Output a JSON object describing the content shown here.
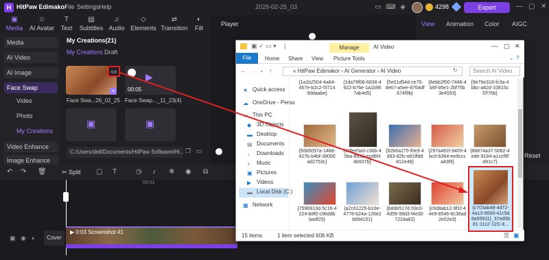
{
  "app": {
    "title": "HitPaw Edimakor",
    "menus": [
      "File",
      "Settings",
      "Help"
    ],
    "doc_title": "2026-02-25_03",
    "coins": "4298",
    "export_label": "Export"
  },
  "toolbar": {
    "tools": [
      "Media",
      "AI Avatar",
      "Text",
      "Subtitles",
      "Audio",
      "Elements",
      "Transition",
      "Filt"
    ],
    "icons": [
      "media-icon",
      "avatar-icon",
      "text-icon",
      "subtitles-icon",
      "audio-icon",
      "elements-icon",
      "transition-icon",
      "filter-icon"
    ]
  },
  "sidebar": {
    "items": [
      "Media",
      "AI Video",
      "AI Image",
      "Face Swap",
      "Video Enhance",
      "Image Enhance"
    ],
    "sub": [
      "Video",
      "Photo",
      "My Creations"
    ]
  },
  "content": {
    "header": "My Creations(21)",
    "tabs": [
      "My Creations",
      "Draft"
    ],
    "items": [
      {
        "label": "Face Swa...26_02_25"
      },
      {
        "label": "Face Swap..._11_23(4)",
        "time": "00:05"
      }
    ],
    "path": "C:/Users/dell/Documents/HitPaw Software/Hi..."
  },
  "player": {
    "label": "Player"
  },
  "right": {
    "tabs": [
      "View",
      "Animation",
      "Color",
      "AIGC"
    ],
    "reset": "Reset"
  },
  "timeline": {
    "split": "Split",
    "ruler": "00:01",
    "cover": "Cover",
    "clip_time": "0:03",
    "clip_name": "Screenshot 41"
  },
  "explorer": {
    "title": "AI Video",
    "manage": "Manage",
    "tabs": [
      "File",
      "Home",
      "Share",
      "View",
      "Picture Tools"
    ],
    "path": [
      "HitPaw Edimakor",
      "AI Generator",
      "AI Video"
    ],
    "search_placeholder": "Search AI Video",
    "nav": [
      "Quick access",
      "OneDrive - Perso",
      "This PC",
      "3D Objects",
      "Desktop",
      "Documents",
      "Downloads",
      "Music",
      "Pictures",
      "Videos",
      "Local Disk (C:)",
      "Network"
    ],
    "status_items": "15 items",
    "status_sel": "1 item selected  606 KB",
    "row1": [
      "{1a1b2504-4a84-457e-b2c2-f3714 9ddaabe}",
      "{1da76f06-6836-4 922-b76e-1a1b96 7ab4d5}",
      "{5e01d54d-ce75-4e67-a5ee-8764df 674f9b}",
      "{6ebb2f50-7446-4 b6f-b5e1-2bf75b 3e4593}",
      "{9e76e318-fc3a-4 bbc-a82d-10815c f2f76b}"
    ],
    "row2": [
      "{50b5097a-148d-427b-b4bf-38000 ad2753c}",
      "{60fee5a3-c36b-4 0ba-8932-ecd6f4 4b937b}",
      "{92b6a275-f0e9-4 d93-82fc-e81ffdd 812e48}",
      "{297a481f-9409-4 bc0-b364-ee9ccc a43f9}",
      "{88874a37-5082-4 ede-9184-a1ccf9f d91c7}"
    ],
    "row3": [
      "{7596913d-5c16-4 224-b8f0-c96ddb badf25}",
      "{a2c61225-b10e-4778-b24a-126e2 b894151}",
      "{b8de517d-59c0-4d59-99d3-f4e30 7224a82}",
      "{c6d8ab12-9f1f-4 4e9-8546-6c36ad 2e52e3}",
      "{c703ab48-4d72-4a13-9693-41c5d 8a55911}_37ed0b 81-11c2-11f1-8..."
    ]
  }
}
